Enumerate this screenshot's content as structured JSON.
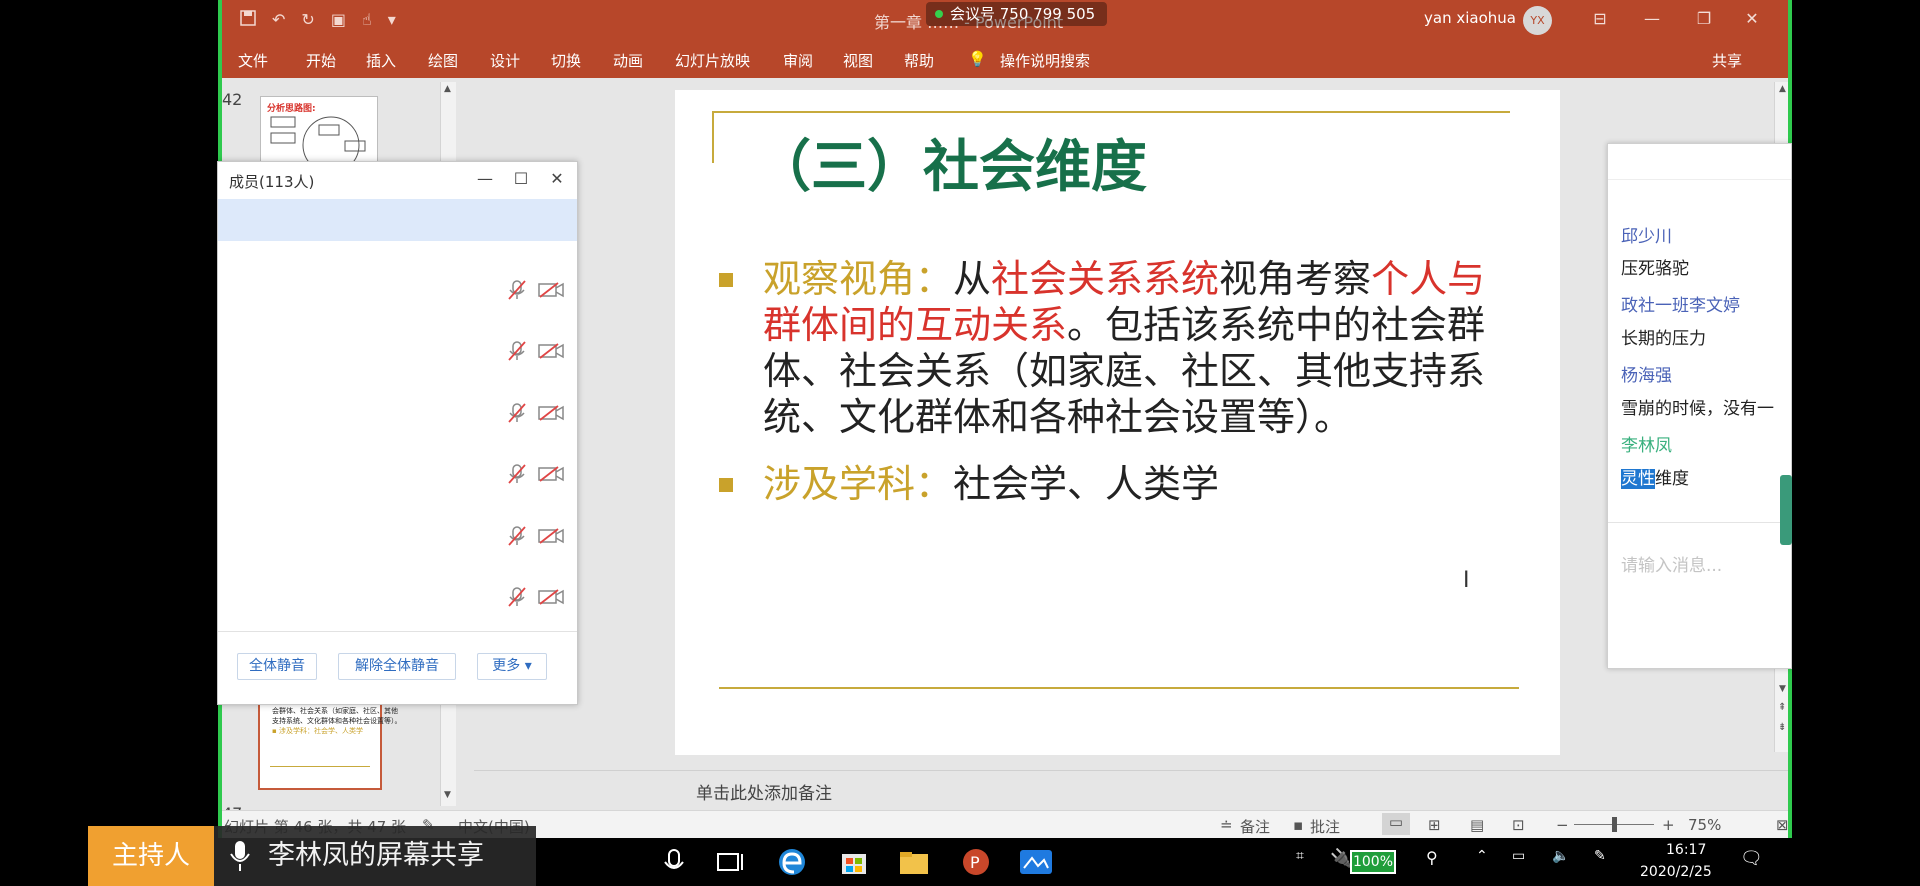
{
  "window": {
    "doc_title": "第一章 …… - PowerPoint",
    "meeting_number": "会议号 750 799 505",
    "user_name": "yan xiaohua",
    "avatar_initials": "YX"
  },
  "ribbon": {
    "tabs": [
      "文件",
      "开始",
      "插入",
      "绘图",
      "设计",
      "切换",
      "动画",
      "幻灯片放映",
      "审阅",
      "视图",
      "帮助",
      "操作说明搜索"
    ],
    "share": "共享"
  },
  "thumbnails": {
    "top_number": "42",
    "top_thumb_title": "分析思路图:",
    "bottom_number": "47",
    "active_thumb_lines": [
      "会群体、社会关系（如家庭、社区、其他",
      "支持系统、文化群体和各种社会设置等）。",
      "▪ 涉及学科：社会学、人类学"
    ]
  },
  "slide": {
    "heading": "（三）社会维度",
    "bullet1": {
      "label": "观察视角：",
      "t1": "从",
      "r1": "社会关系系统",
      "t2": "视角考察",
      "r2": "个人与群体间的互动关系",
      "t3": "。包括该系统中的社会群体、社会关系（如家庭、社区、其他支持系统、文化群体和各种社会设置等）。"
    },
    "bullet2": {
      "label": "涉及学科：",
      "text": "社会学、人类学"
    }
  },
  "notes": {
    "placeholder": "单击此处添加备注"
  },
  "statusbar": {
    "slide_info": "幻灯片 第 46 张，共 47 张",
    "language": "中文(中国)",
    "notes": "备注",
    "comments": "批注",
    "zoom": "75%"
  },
  "member_panel": {
    "title": "成员(113人)",
    "mute_all": "全体静音",
    "unmute_all": "解除全体静音",
    "more": "更多"
  },
  "chat": {
    "messages": [
      {
        "name": "邱少川",
        "text": "压死骆驼"
      },
      {
        "name": "政社一班李文婷",
        "text": "长期的压力"
      },
      {
        "name": "杨海强",
        "text": "雪崩的时候，没有一"
      },
      {
        "name": "李林凤",
        "text_selected": "灵性",
        "text_rest": "维度"
      }
    ],
    "input_placeholder": "请输入消息..."
  },
  "taskbar": {
    "host_badge": "主持人",
    "share_banner": "李林凤的屏幕共享",
    "battery": "100%",
    "time": "16:17",
    "date": "2020/2/25"
  },
  "colors": {
    "ppt_red": "#b7472a",
    "heading_green": "#17704a",
    "keyword_gold": "#c9a22b",
    "keyword_red": "#d8332c",
    "host_orange": "#f0a030"
  }
}
